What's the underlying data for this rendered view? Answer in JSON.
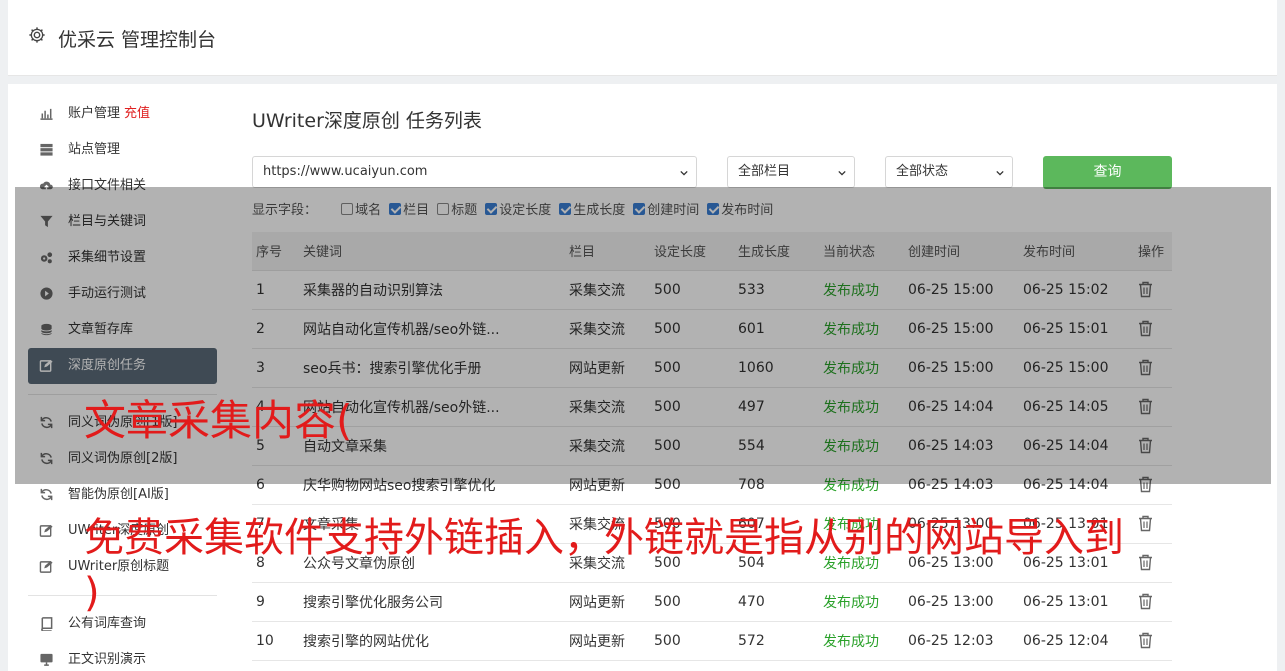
{
  "app": {
    "title": "优采云 管理控制台"
  },
  "sidebar": {
    "items": [
      {
        "label": "账户管理",
        "badge": "充值",
        "icon": "bar-chart-icon"
      },
      {
        "label": "站点管理",
        "icon": "server-icon"
      },
      {
        "label": "接口文件相关",
        "icon": "cloud-upload-icon"
      },
      {
        "label": "栏目与关键词",
        "icon": "filter-icon"
      },
      {
        "label": "采集细节设置",
        "icon": "cogs-icon"
      },
      {
        "label": "手动运行测试",
        "icon": "play-circle-icon"
      },
      {
        "label": "文章暂存库",
        "icon": "database-icon"
      },
      {
        "label": "深度原创任务",
        "icon": "edit-icon",
        "active": true
      }
    ],
    "items2": [
      {
        "label": "同义词伪原创[1版]",
        "icon": "refresh-icon"
      },
      {
        "label": "同义词伪原创[2版]",
        "icon": "refresh-icon"
      },
      {
        "label": "智能伪原创[AI版]",
        "icon": "refresh-icon"
      },
      {
        "label": "UWriter深度原创",
        "icon": "edit-icon"
      },
      {
        "label": "UWriter原创标题",
        "icon": "edit-icon"
      }
    ],
    "items3": [
      {
        "label": "公有词库查询",
        "icon": "book-icon"
      },
      {
        "label": "正文识别演示",
        "icon": "desktop-icon"
      }
    ]
  },
  "main": {
    "title": "UWriter深度原创 任务列表",
    "filters": {
      "site": "https://www.ucaiyun.com",
      "column": "全部栏目",
      "status": "全部状态",
      "query_label": "查询"
    },
    "display_fields": {
      "label": "显示字段：",
      "options": [
        {
          "label": "域名",
          "checked": false
        },
        {
          "label": "栏目",
          "checked": true
        },
        {
          "label": "标题",
          "checked": false
        },
        {
          "label": "设定长度",
          "checked": true
        },
        {
          "label": "生成长度",
          "checked": true
        },
        {
          "label": "创建时间",
          "checked": true
        },
        {
          "label": "发布时间",
          "checked": true
        }
      ]
    },
    "table": {
      "headers": [
        "序号",
        "关键词",
        "栏目",
        "设定长度",
        "生成长度",
        "当前状态",
        "创建时间",
        "发布时间",
        "操作"
      ],
      "rows": [
        [
          "1",
          "采集器的自动识别算法",
          "采集交流",
          "500",
          "533",
          "发布成功",
          "06-25 15:00",
          "06-25 15:02"
        ],
        [
          "2",
          "网站自动化宣传机器/seo外链...",
          "采集交流",
          "500",
          "601",
          "发布成功",
          "06-25 15:00",
          "06-25 15:01"
        ],
        [
          "3",
          "seo兵书：搜索引擎优化手册",
          "网站更新",
          "500",
          "1060",
          "发布成功",
          "06-25 15:00",
          "06-25 15:00"
        ],
        [
          "4",
          "网站自动化宣传机器/seo外链...",
          "采集交流",
          "500",
          "497",
          "发布成功",
          "06-25 14:04",
          "06-25 14:05"
        ],
        [
          "5",
          "自动文章采集",
          "采集交流",
          "500",
          "554",
          "发布成功",
          "06-25 14:03",
          "06-25 14:04"
        ],
        [
          "6",
          "庆华购物网站seo搜索引擎优化",
          "网站更新",
          "500",
          "708",
          "发布成功",
          "06-25 14:03",
          "06-25 14:04"
        ],
        [
          "7",
          "文章采集",
          "采集交流",
          "500",
          "607",
          "发布成功",
          "06-25 13:00",
          "06-25 13:01"
        ],
        [
          "8",
          "公众号文章伪原创",
          "采集交流",
          "500",
          "504",
          "发布成功",
          "06-25 13:00",
          "06-25 13:01"
        ],
        [
          "9",
          "搜索引擎优化服务公司",
          "网站更新",
          "500",
          "470",
          "发布成功",
          "06-25 13:00",
          "06-25 13:01"
        ],
        [
          "10",
          "搜索引擎的网站优化",
          "网站更新",
          "500",
          "572",
          "发布成功",
          "06-25 12:03",
          "06-25 12:04"
        ]
      ]
    }
  },
  "captions": {
    "line1": "文章采集内容(",
    "line2": "免费采集软件支持外链插入，外链就是指从别的网站导入到",
    "line3": ")"
  },
  "colors": {
    "accent": "#5cb85c",
    "active_nav": "#5b6b79",
    "success": "#2aa12a",
    "caption": "#e21b1b"
  }
}
